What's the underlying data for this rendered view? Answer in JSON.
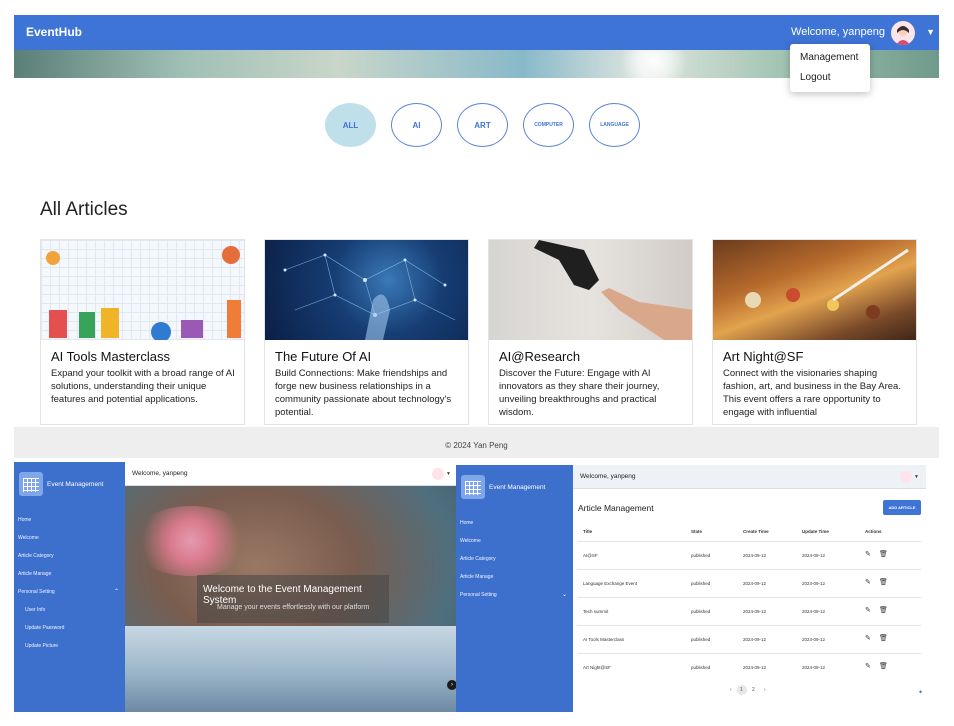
{
  "top": {
    "brand": "EventHub",
    "welcome": "Welcome, yanpeng",
    "dropdown": {
      "management": "Management",
      "logout": "Logout"
    },
    "categories": [
      "ALL",
      "AI",
      "ART",
      "COMPUTER",
      "LANGUAGE"
    ],
    "active_category": "ALL",
    "section_title": "All Articles",
    "articles": [
      {
        "title": "AI Tools Masterclass",
        "desc": "Expand your toolkit with a broad range of AI solutions, understanding their unique features and potential applications."
      },
      {
        "title": "The Future Of AI",
        "desc": "Build Connections: Make friendships and forge new business relationships in a community passionate about technology's potential."
      },
      {
        "title": "AI@Research",
        "desc": "Discover the Future: Engage with AI innovators as they share their journey, unveiling breakthroughs and practical wisdom."
      },
      {
        "title": "Art Night@SF",
        "desc": "Connect with the visionaries shaping fashion, art, and business in the Bay Area. This event offers a rare opportunity to engage with influential"
      }
    ],
    "footer": "© 2024 Yan Peng"
  },
  "left_app": {
    "sidebar_title": "Event Management",
    "welcome": "Welcome, yanpeng",
    "menu": [
      "Home",
      "Welcome",
      "Article Category",
      "Article Manage",
      "Personal Setting"
    ],
    "submenu": [
      "User Info",
      "Update Password",
      "Update Picture"
    ],
    "hero_title": "Welcome to the Event Management System",
    "hero_subtitle": "Manage your events effortlessly with our platform"
  },
  "right_app": {
    "sidebar_title": "Event Management",
    "welcome": "Welcome, yanpeng",
    "menu": [
      "Home",
      "Welcome",
      "Article Category",
      "Article Manage",
      "Personal Setting"
    ],
    "page_title": "Article Management",
    "add_button": "ADD ARTICLE",
    "columns": [
      "Title",
      "State",
      "Create Time",
      "Update Time",
      "Actions"
    ],
    "rows": [
      [
        "AI@SF",
        "published",
        "2024-09-12",
        "2024-09-12"
      ],
      [
        "Language Exchange Event",
        "published",
        "2024-09-12",
        "2024-09-12"
      ],
      [
        "Tech summit",
        "published",
        "2024-09-12",
        "2024-09-12"
      ],
      [
        "AI Tools Masterclass",
        "published",
        "2024-09-12",
        "2024-09-12"
      ],
      [
        "Art Night@SF",
        "published",
        "2024-09-12",
        "2024-09-12"
      ]
    ],
    "pager": {
      "prev": "‹",
      "page1": "1",
      "page2": "2",
      "next": "›"
    }
  },
  "icons": {
    "edit": "pencil-icon",
    "delete": "trash-icon",
    "avatar": "avatar-icon"
  },
  "colors": {
    "brand_blue": "#3d74d6",
    "sidebar_blue": "#3d6fcc",
    "active_pill": "#bfe0ea"
  }
}
